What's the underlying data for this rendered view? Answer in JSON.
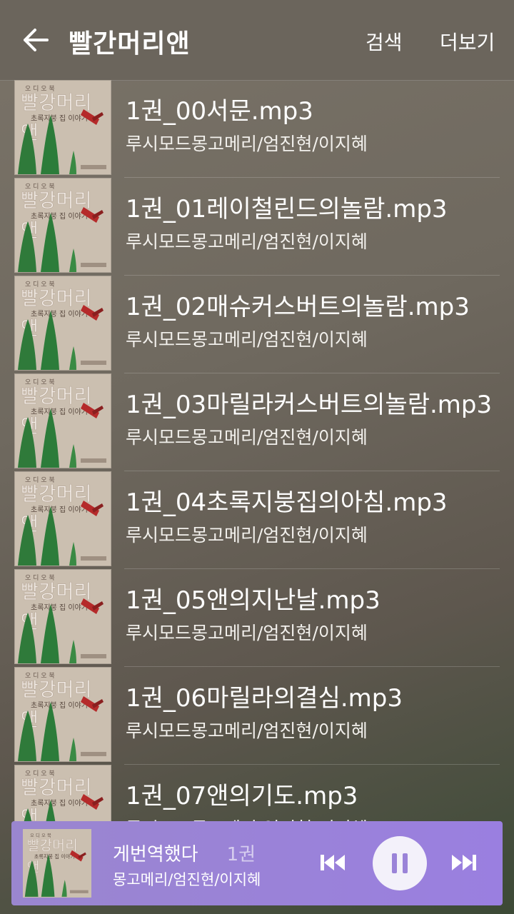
{
  "header": {
    "title": "빨간머리앤",
    "search_label": "검색",
    "more_label": "더보기"
  },
  "cover": {
    "top_text": "오 디 오 북",
    "title": "빨강머리",
    "title2": "앤",
    "subtitle": "초록지붕 집 이야기"
  },
  "tracks": [
    {
      "title": "1권_00서문.mp3",
      "artist": "루시모드몽고메리/엄진현/이지혜"
    },
    {
      "title": "1권_01레이철린드의놀람.mp3",
      "artist": "루시모드몽고메리/엄진현/이지혜"
    },
    {
      "title": "1권_02매슈커스버트의놀람.mp3",
      "artist": "루시모드몽고메리/엄진현/이지혜"
    },
    {
      "title": "1권_03마릴라커스버트의놀람.mp3",
      "artist": "루시모드몽고메리/엄진현/이지혜"
    },
    {
      "title": "1권_04초록지붕집의아침.mp3",
      "artist": "루시모드몽고메리/엄진현/이지혜"
    },
    {
      "title": "1권_05앤의지난날.mp3",
      "artist": "루시모드몽고메리/엄진현/이지혜"
    },
    {
      "title": "1권_06마릴라의결심.mp3",
      "artist": "루시모드몽고메리/엄진현/이지혜"
    },
    {
      "title": "1권_07앤의기도.mp3",
      "artist": "루시모드몽고메리/엄진현/이지혜"
    }
  ],
  "player": {
    "title": "게번역했다",
    "title_tail": "1권",
    "artist": "몽고메리/엄진현/이지혜"
  },
  "colors": {
    "accent": "#9a83d8",
    "topbar": "#6b655c"
  }
}
